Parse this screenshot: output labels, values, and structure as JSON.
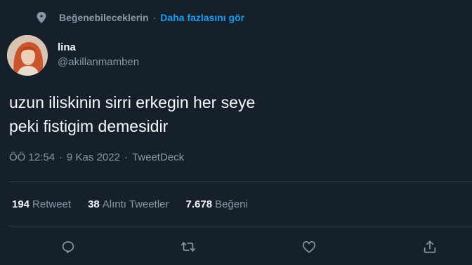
{
  "context": {
    "icon": "sparkle-pin-icon",
    "label": "Beğenebileceklerin",
    "separator": "·",
    "more_link": "Daha fazlasını gör"
  },
  "author": {
    "display_name": "lina",
    "handle": "@akillanmamben",
    "avatar": "profile-avatar"
  },
  "tweet": {
    "lines": [
      "uzun iliskinin sirri erkegin her seye",
      "peki fistigim demesidir"
    ]
  },
  "meta": {
    "time": "ÖÖ 12:54",
    "date": "9 Kas 2022",
    "source": "TweetDeck",
    "separator": "·"
  },
  "stats": [
    {
      "count": "194",
      "label": "Retweet"
    },
    {
      "count": "38",
      "label": "Alıntı Tweetler"
    },
    {
      "count": "7.678",
      "label": "Beğeni"
    }
  ],
  "actions": [
    "reply-icon",
    "retweet-icon",
    "like-icon",
    "share-icon"
  ],
  "colors": {
    "background": "#15202b",
    "text_primary": "#f7f9f9",
    "text_secondary": "#8b98a5",
    "accent": "#1d9bf0",
    "divider": "#38444d"
  }
}
